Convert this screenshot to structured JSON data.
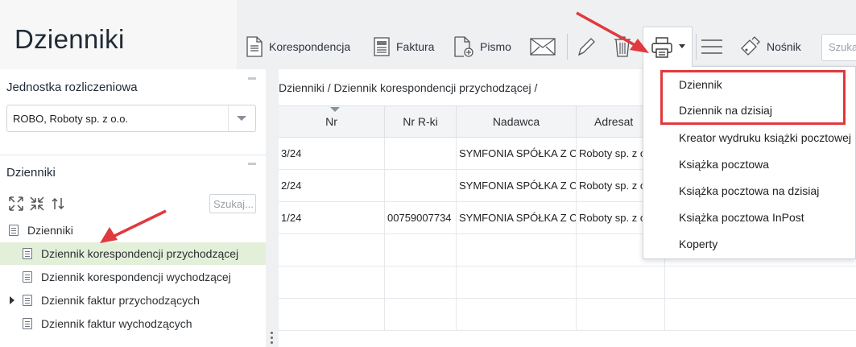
{
  "app": {
    "title": "Dzienniki"
  },
  "toolbar": {
    "korespondencja": "Korespondencja",
    "faktura": "Faktura",
    "pismo": "Pismo",
    "nosnik": "Nośnik",
    "search_placeholder": "Szukaj..."
  },
  "left": {
    "unit_title": "Jednostka rozliczeniowa",
    "unit_value": "ROBO, Roboty sp. z o.o.",
    "journals_title": "Dzienniki",
    "tree_search_placeholder": "Szukaj...",
    "tree": [
      {
        "label": "Dzienniki"
      },
      {
        "label": "Dziennik korespondencji przychodzącej"
      },
      {
        "label": "Dziennik korespondencji wychodzącej"
      },
      {
        "label": "Dziennik faktur przychodzących"
      },
      {
        "label": "Dziennik faktur wychodzących"
      }
    ]
  },
  "main": {
    "breadcrumb": "Dzienniki / Dziennik korespondencji przychodzącej /",
    "columns": [
      "Nr",
      "Nr R-ki",
      "Nadawca",
      "Adresat"
    ],
    "rows": [
      {
        "nr": "3/24",
        "nrrki": "",
        "nadawca": "SYMFONIA SPÓŁKA Z O.O.",
        "adresat": "Roboty sp. z o.o."
      },
      {
        "nr": "2/24",
        "nrrki": "",
        "nadawca": "SYMFONIA SPÓŁKA Z O.O.",
        "adresat": "Roboty sp. z o.o."
      },
      {
        "nr": "1/24",
        "nrrki": "00759007734",
        "nadawca": "SYMFONIA SPÓŁKA Z O.O.",
        "adresat": "Roboty sp. z o.o."
      }
    ]
  },
  "print_menu": {
    "items": [
      "Dziennik",
      "Dziennik na dzisiaj",
      "Kreator wydruku książki pocztowej",
      "Książka pocztowa",
      "Książka pocztowa na dzisiaj",
      "Książka pocztowa InPost",
      "Koperty"
    ]
  },
  "colors": {
    "annotation_red": "#e0393e",
    "selected_row": "#e3efd9",
    "header_bg": "#eef0f2"
  }
}
